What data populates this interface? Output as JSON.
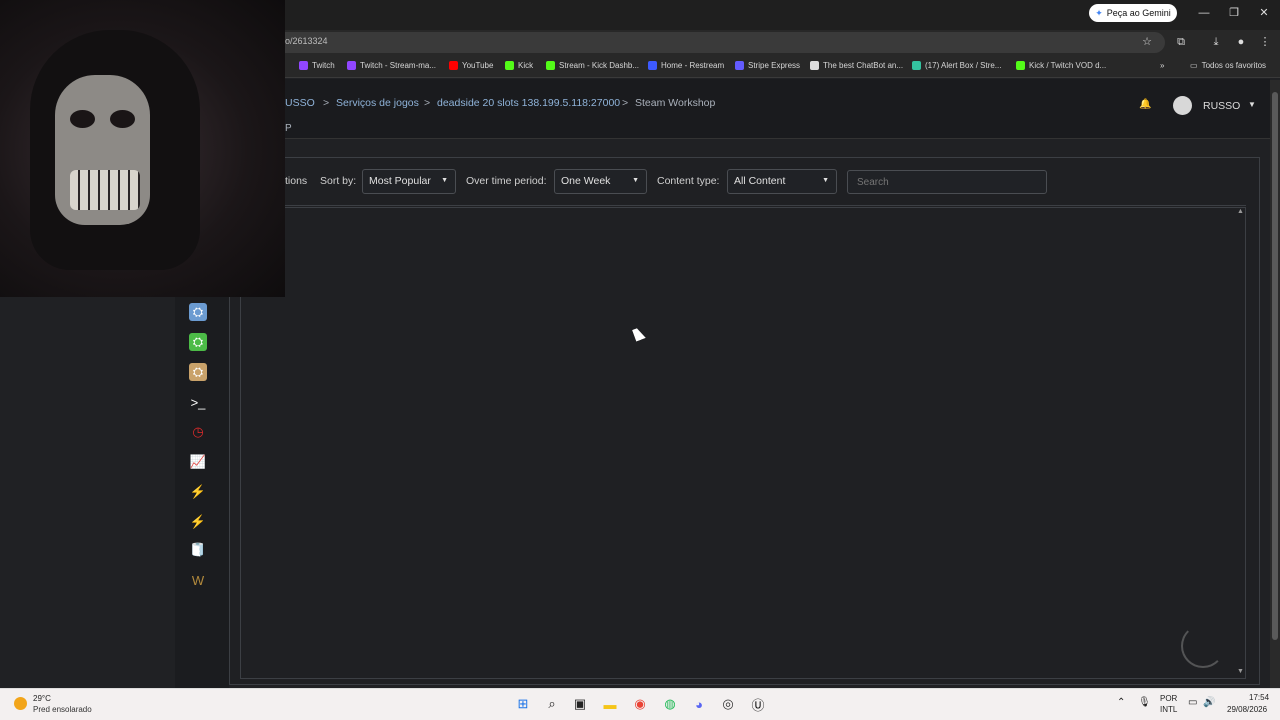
{
  "browser": {
    "gemini_label": "Peça ao Gemini",
    "url": "o/2613324",
    "bookmarks": [
      {
        "label": "Twitch",
        "color": "#9146ff"
      },
      {
        "label": "Twitch - Stream-ma...",
        "color": "#9146ff"
      },
      {
        "label": "YouTube",
        "color": "#ff0000"
      },
      {
        "label": "Kick",
        "color": "#53fc18"
      },
      {
        "label": "Stream - Kick Dashb...",
        "color": "#53fc18"
      },
      {
        "label": "Home - Restream",
        "color": "#3d5afe"
      },
      {
        "label": "Stripe Express",
        "color": "#635bff"
      },
      {
        "label": "The best ChatBot an...",
        "color": "#dddddd"
      },
      {
        "label": "(17) Alert Box / Stre...",
        "color": "#34c3a0"
      },
      {
        "label": "Kick / Twitch VOD d...",
        "color": "#53fc18"
      }
    ],
    "all_bookmarks": "Todos os favoritos",
    "more_glyph": "»"
  },
  "header": {
    "breadcrumb": [
      "USSO",
      "Serviços de jogos",
      "deadside 20 slots 138.199.5.118:27000",
      "Steam Workshop"
    ],
    "separator": ">",
    "subtitle": "P",
    "username": "RUSSO",
    "bell_glyph": "🔔"
  },
  "toolbar": {
    "partial_label": "tions",
    "sort_label": "Sort by:",
    "sort_value": "Most Popular",
    "period_label": "Over time period:",
    "period_value": "One Week",
    "content_label": "Content type:",
    "content_value": "All Content",
    "search_placeholder": "Search"
  },
  "sidebar_icons": [
    {
      "name": "steam-blue-icon",
      "glyph": "⛭",
      "color": "#6b9bd1"
    },
    {
      "name": "steam-green-icon",
      "glyph": "⛭",
      "color": "#4cbb47"
    },
    {
      "name": "steam-tan-icon",
      "glyph": "⛭",
      "color": "#c9a26a"
    },
    {
      "name": "console-icon",
      "glyph": ">_",
      "color": "#ffffff"
    },
    {
      "name": "clock-icon",
      "glyph": "◷",
      "color": "#e02b2b"
    },
    {
      "name": "chart-icon",
      "glyph": "📈",
      "color": "#9fb7d6"
    },
    {
      "name": "lightning-icon",
      "glyph": "⚡",
      "color": "#f2e01c"
    },
    {
      "name": "lightning-icon-2",
      "glyph": "⚡",
      "color": "#f2e01c"
    },
    {
      "name": "toilet-paper-icon",
      "glyph": "🧻",
      "color": "#ffffff"
    },
    {
      "name": "w-logo-icon",
      "glyph": "W",
      "color": "#b38a3c"
    }
  ],
  "taskbar": {
    "temperature": "29°C",
    "weather": "Pred ensolarado",
    "lang_top": "POR",
    "lang_bottom": "INTL",
    "time": "17:54",
    "date": "29/08/2026",
    "apps": [
      {
        "name": "windows-start-icon",
        "glyph": "⊞",
        "color": "#1a73e8"
      },
      {
        "name": "search-icon",
        "glyph": "⌕",
        "color": "#222222"
      },
      {
        "name": "task-view-icon",
        "glyph": "▣",
        "color": "#222222"
      },
      {
        "name": "file-explorer-icon",
        "glyph": "▬",
        "color": "#f5c518"
      },
      {
        "name": "chrome-icon",
        "glyph": "◉",
        "color": "#ea4335"
      },
      {
        "name": "spotify-icon",
        "glyph": "◍",
        "color": "#1db954"
      },
      {
        "name": "discord-icon",
        "glyph": "◕",
        "color": "#5865f2"
      },
      {
        "name": "obs-icon",
        "glyph": "◎",
        "color": "#333333"
      },
      {
        "name": "unreal-icon",
        "glyph": "Ⓤ",
        "color": "#111111"
      }
    ]
  }
}
